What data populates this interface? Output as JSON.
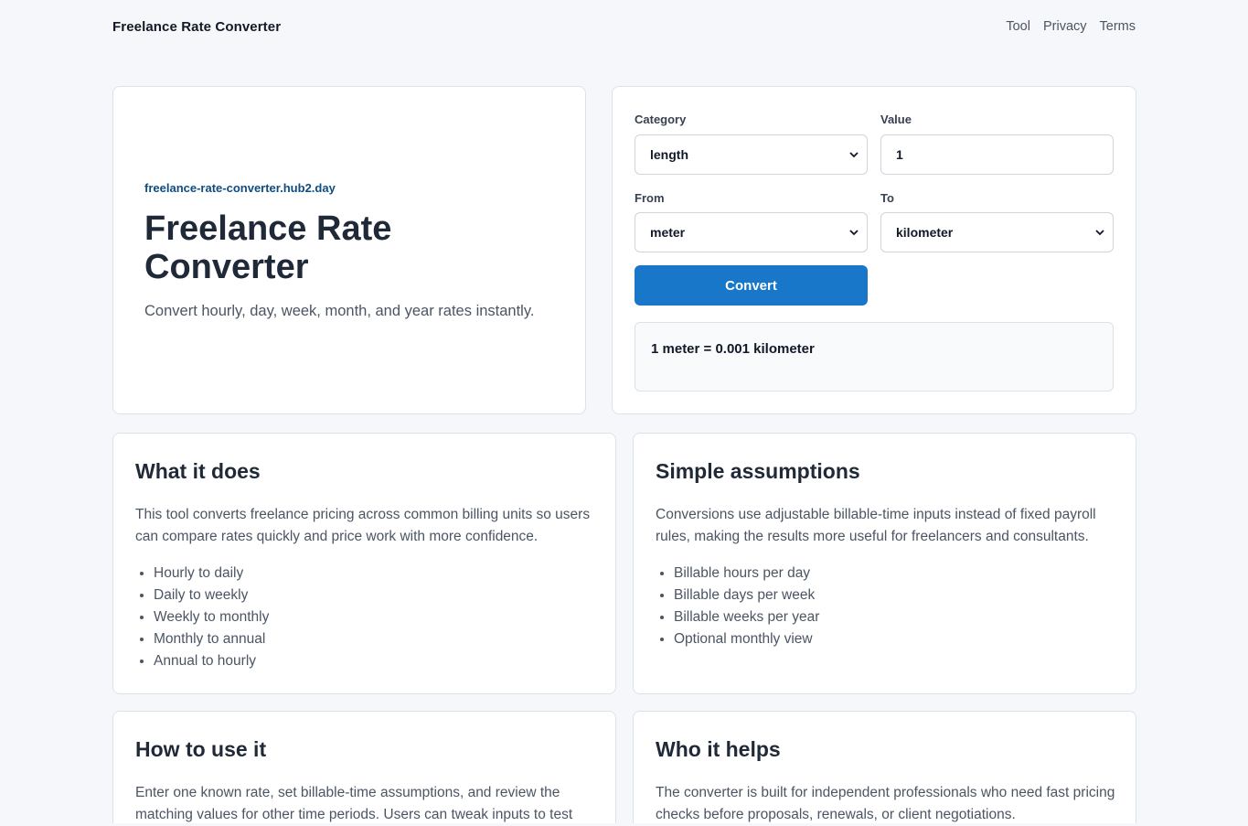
{
  "header": {
    "brand": "Freelance Rate Converter",
    "nav": [
      "Tool",
      "Privacy",
      "Terms"
    ]
  },
  "hero": {
    "domain": "freelance-rate-converter.hub2.day",
    "title": "Freelance Rate Converter",
    "lead": "Convert hourly, day, week, month, and year rates instantly."
  },
  "converter": {
    "category_label": "Category",
    "category_value": "length",
    "value_label": "Value",
    "value": "1",
    "from_label": "From",
    "from_value": "meter",
    "to_label": "To",
    "to_value": "kilometer",
    "convert_label": "Convert",
    "result": "1 meter = 0.001 kilometer"
  },
  "sections": [
    {
      "title": "What it does",
      "body": "This tool converts freelance pricing across common billing units so users can compare rates quickly and price work with more confidence.",
      "items": [
        "Hourly to daily",
        "Daily to weekly",
        "Weekly to monthly",
        "Monthly to annual",
        "Annual to hourly"
      ]
    },
    {
      "title": "Simple assumptions",
      "body": "Conversions use adjustable billable-time inputs instead of fixed payroll rules, making the results more useful for freelancers and consultants.",
      "items": [
        "Billable hours per day",
        "Billable days per week",
        "Billable weeks per year",
        "Optional monthly view"
      ]
    },
    {
      "title": "How to use it",
      "body": "Enter one known rate, set billable-time assumptions, and review the matching values for other time periods. Users can tweak inputs to test"
    },
    {
      "title": "Who it helps",
      "body": "The converter is built for independent professionals who need fast pricing checks before proposals, renewals, or client negotiations."
    }
  ],
  "colors": {
    "accent": "#1877c9",
    "domain_link": "#0f4c81",
    "background": "#f5f7fa"
  }
}
